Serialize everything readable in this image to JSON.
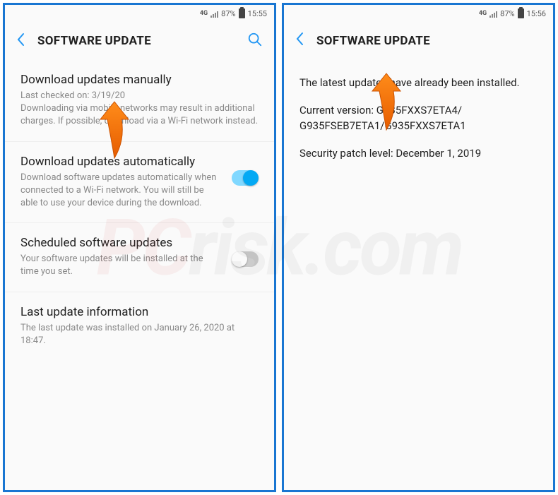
{
  "left": {
    "status": {
      "network": "4G",
      "battery": "87%",
      "time": "15:55"
    },
    "header": {
      "title": "SOFTWARE UPDATE"
    },
    "items": {
      "manual": {
        "title": "Download updates manually",
        "desc": "Last checked on: 3/19/20\nDownloading via mobile networks may result in additional charges. If possible, download via a Wi-Fi network instead."
      },
      "auto": {
        "title": "Download updates automatically",
        "desc": "Download software updates automatically when connected to a Wi-Fi network. You will still be able to use your device during the download.",
        "toggle": true
      },
      "scheduled": {
        "title": "Scheduled software updates",
        "desc": "Your software updates will be installed at the time you set.",
        "toggle": false
      },
      "lastinfo": {
        "title": "Last update information",
        "desc": "The last update was installed on January 26, 2020 at 18:47."
      }
    }
  },
  "right": {
    "status": {
      "network": "4G",
      "battery": "87%",
      "time": "15:56"
    },
    "header": {
      "title": "SOFTWARE UPDATE"
    },
    "info": {
      "line1": "The latest updates have already been installed.",
      "line2": "Current version: G935FXXS7ETA4/\nG935FSEB7ETA1/G935FXXS7ETA1",
      "line3": "Security patch level: December 1, 2019"
    }
  },
  "watermark": {
    "prefix": "PC",
    "suffix": "risk.com"
  }
}
